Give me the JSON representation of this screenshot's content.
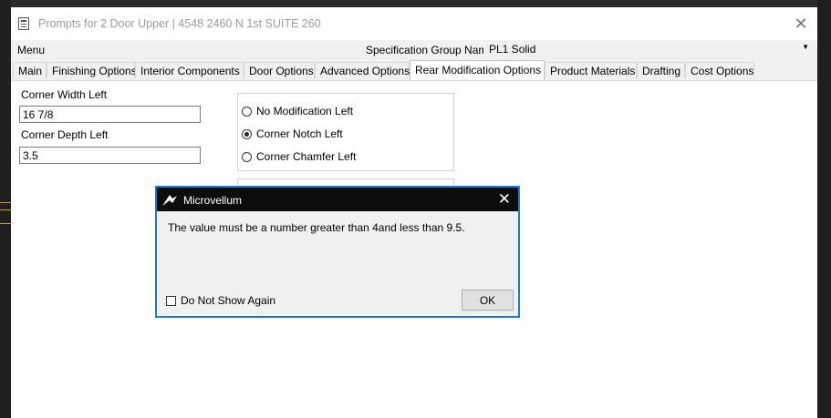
{
  "window": {
    "title": "Prompts for 2 Door Upper | 4548 2460 N 1st SUITE 260",
    "close_icon": "close-icon"
  },
  "menu": {
    "label": "Menu",
    "spec_group_label": "Specification Group Name",
    "spec_group_value": "PL1 Solid"
  },
  "tabs": [
    {
      "label": "Main"
    },
    {
      "label": "Finishing Options"
    },
    {
      "label": "Interior Components"
    },
    {
      "label": "Door Options"
    },
    {
      "label": "Advanced Options"
    },
    {
      "label": "Rear Modification Options",
      "active": true
    },
    {
      "label": "Product Materials"
    },
    {
      "label": "Drafting"
    },
    {
      "label": "Cost Options"
    }
  ],
  "form": {
    "corner_width_label": "Corner Width Left",
    "corner_width_value": "16 7/8",
    "corner_depth_label": "Corner Depth Left",
    "corner_depth_value": "3.5",
    "radio_options": [
      {
        "label": "No Modification Left",
        "checked": false
      },
      {
        "label": "Corner Notch Left",
        "checked": true
      },
      {
        "label": "Corner Chamfer Left",
        "checked": false
      }
    ]
  },
  "dialog": {
    "title": "Microvellum",
    "message": "The value must be a number greater than 4and less than 9.5.",
    "checkbox_label": "Do Not Show Again",
    "checkbox_checked": false,
    "ok_label": "OK",
    "border_color": "#1e7ad1"
  }
}
